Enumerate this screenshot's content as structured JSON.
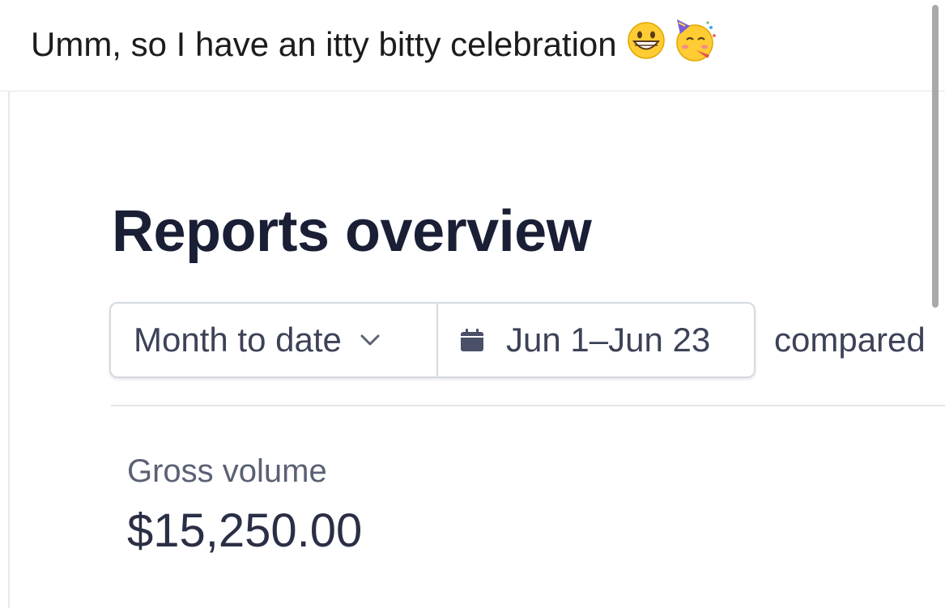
{
  "post": {
    "text": "Umm, so I have an itty bitty celebration",
    "emojis": [
      "grinning-face-icon",
      "partying-face-icon"
    ]
  },
  "reports": {
    "title": "Reports overview",
    "range_select": "Month to date",
    "date_range": "Jun 1–Jun 23",
    "compared_label": "compared",
    "metric": {
      "label": "Gross volume",
      "value": "$15,250.00"
    }
  },
  "colors": {
    "title_text": "#1a1f36",
    "body_text": "#3c4257",
    "muted_text": "#5a6173",
    "border": "#d5d9e0"
  }
}
